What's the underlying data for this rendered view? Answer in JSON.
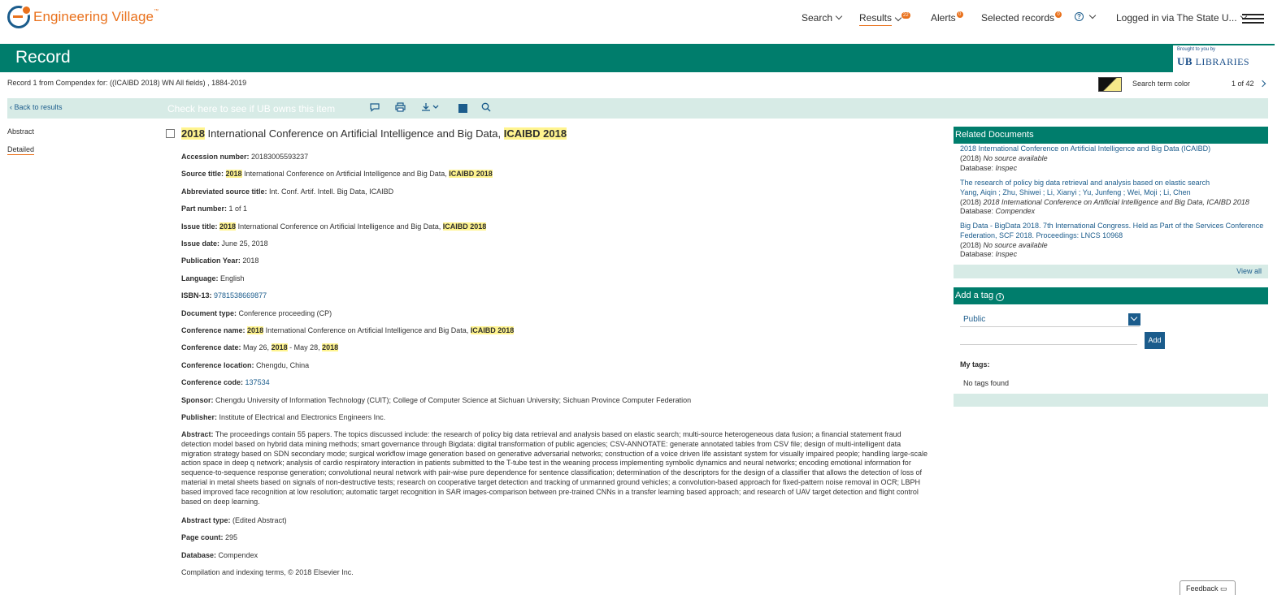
{
  "app": {
    "logo_text": "Engineering Village",
    "logo_tm": "™"
  },
  "nav": {
    "search": "Search",
    "results": "Results",
    "results_count": "22",
    "alerts": "Alerts",
    "alerts_count": "0",
    "selected_records": "Selected records",
    "selected_count": "0",
    "help": "?",
    "login": "Logged in via The State U..."
  },
  "header": {
    "title": "Record",
    "library_brought": "Brought to you by",
    "library_ub": "UB",
    "library_name": "LIBRARIES"
  },
  "info": {
    "record_line": "Record 1 from Compendex for: ((ICAIBD 2018) WN All fields) , 1884-2019",
    "search_term_color": "Search term color",
    "pager": "1 of 42"
  },
  "toolbar": {
    "back": "Back to results",
    "check_ub": "Check here to see if UB owns this item"
  },
  "sidebar": {
    "abstract": "Abstract",
    "detailed": "Detailed"
  },
  "record": {
    "title_hl1": "2018",
    "title_mid": " International Conference on Artificial Intelligence and Big Data, ",
    "title_hl2": "ICAIBD 2018",
    "fields": {
      "accession_label": "Accession number:",
      "accession_value": "20183005593237",
      "source_label": "Source title:",
      "source_hl1": "2018",
      "source_mid": " International Conference on Artificial Intelligence and Big Data, ",
      "source_hl2": "ICAIBD 2018",
      "abbrev_label": "Abbreviated source title:",
      "abbrev_value": "Int. Conf. Artif. Intell. Big Data, ICAIBD",
      "part_label": "Part number:",
      "part_value": "1 of 1",
      "issue_title_label": "Issue title:",
      "issue_hl1": "2018",
      "issue_mid": " International Conference on Artificial Intelligence and Big Data, ",
      "issue_hl2": "ICAIBD 2018",
      "issue_date_label": "Issue date:",
      "issue_date_value": "June 25, 2018",
      "pub_year_label": "Publication Year:",
      "pub_year_value": "2018",
      "language_label": "Language:",
      "language_value": "English",
      "isbn_label": "ISBN-13:",
      "isbn_value": "9781538669877",
      "doctype_label": "Document type:",
      "doctype_value": "Conference proceeding (CP)",
      "conf_name_label": "Conference name:",
      "conf_hl1": "2018",
      "conf_mid": " International Conference on Artificial Intelligence and Big Data, ",
      "conf_hl2": "ICAIBD 2018",
      "conf_date_label": "Conference date:",
      "conf_date_a": "May 26, ",
      "conf_date_hl1": "2018",
      "conf_date_b": " - May 28, ",
      "conf_date_hl2": "2018",
      "conf_loc_label": "Conference location:",
      "conf_loc_value": "Chengdu, China",
      "conf_code_label": "Conference code:",
      "conf_code_value": "137534",
      "sponsor_label": "Sponsor:",
      "sponsor_value": "Chengdu University of Information Technology (CUIT); College of Computer Science at Sichuan University; Sichuan Province Computer Federation",
      "publisher_label": "Publisher:",
      "publisher_value": "Institute of Electrical and Electronics Engineers Inc.",
      "abstract_label": "Abstract:",
      "abstract_value": "The proceedings contain 55 papers. The topics discussed include: the research of policy big data retrieval and analysis based on elastic search; multi-source heterogeneous data fusion; a financial statement fraud detection model based on hybrid data mining methods; smart governance through Bigdata: digital transformation of public agencies; CSV-ANNOTATE: generate annotated tables from CSV file; design of multi-intelligent data migration strategy based on SDN secondary mode; surgical workflow image generation based on generative adversarial networks; construction of a voice driven life assistant system for visually impaired people; handling large-scale action space in deep q network; analysis of cardio respiratory interaction in patients submitted to the T-tube test in the weaning process implementing symbolic dynamics and neural networks; encoding emotional information for sequence-to-sequence response generation; convolutional neural network with pair-wise pure dependence for sentence classification; determination of the descriptors for the design of a classifier that allows the detection of loss of material in metal sheets based on signals of non-destructive tests; research on cooperative target detection and tracking of unmanned ground vehicles; a convolution-based approach for fixed-pattern noise removal in OCR; LBPH based improved face recognition at low resolution; automatic target recognition in SAR images-comparison between pre-trained CNNs in a transfer learning based approach; and research of UAV target detection and flight control based on deep learning.",
      "abstract_type_label": "Abstract type:",
      "abstract_type_value": "(Edited Abstract)",
      "page_count_label": "Page count:",
      "page_count_value": "295",
      "database_label": "Database:",
      "database_value": "Compendex",
      "copyright": "Compilation and indexing terms, © 2018 Elsevier Inc."
    }
  },
  "related": {
    "heading": "Related Documents",
    "items": [
      {
        "title": "2018 International Conference on Artificial Intelligence and Big Data (ICAIBD)",
        "year": "(2018)",
        "source": "No source available",
        "db_label": "Database:",
        "db": "Inspec"
      },
      {
        "title": "The research of policy big data retrieval and analysis based on elastic search",
        "authors": "Yang, Aiqin ; Zhu, Shiwei ; Li, Xianyi ; Yu, Junfeng ; Wei, Moji ; Li, Chen",
        "year": "(2018)",
        "source": "2018 International Conference on Artificial Intelligence and Big Data, ICAIBD 2018",
        "db_label": "Database:",
        "db": "Compendex"
      },
      {
        "title": "Big Data - BigData 2018. 7th International Congress. Held as Part of the Services Conference Federation, SCF 2018. Proceedings: LNCS 10968",
        "year": "(2018)",
        "source": "No source available",
        "db_label": "Database:",
        "db": "Inspec"
      }
    ],
    "view_all": "View all"
  },
  "tags": {
    "heading": "Add a tag",
    "select_value": "Public",
    "add": "Add",
    "my_tags": "My tags:",
    "no_tags": "No tags found"
  },
  "feedback": "Feedback"
}
